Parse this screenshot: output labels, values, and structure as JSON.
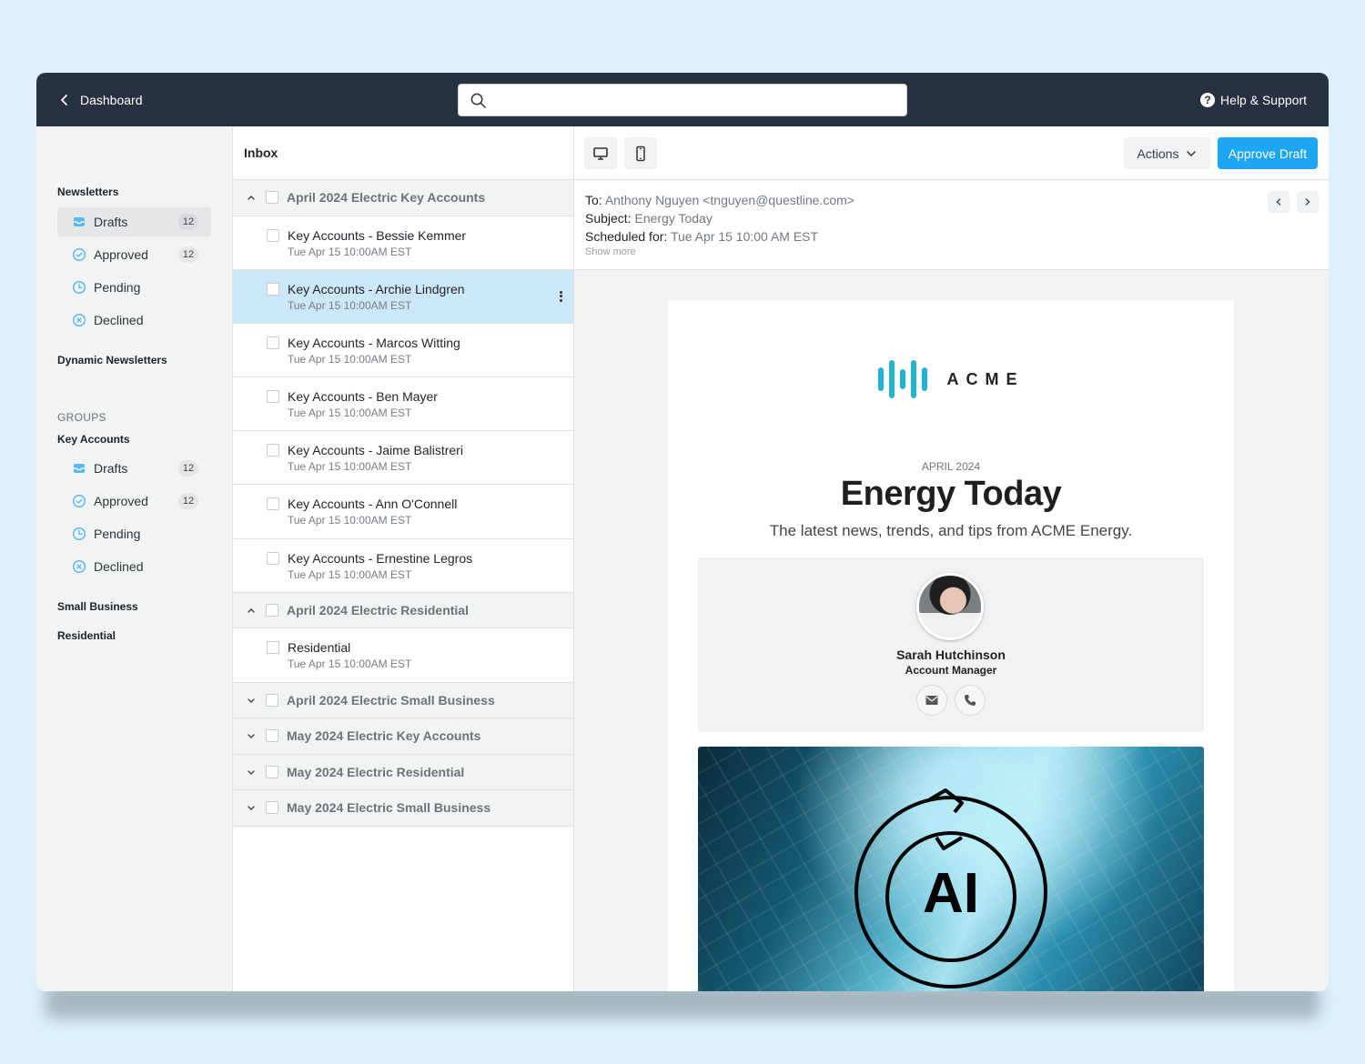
{
  "topbar": {
    "back_label": "Dashboard",
    "search_placeholder": "",
    "help_label": "Help & Support"
  },
  "sidebar": {
    "newsletters_heading": "Newsletters",
    "newsletter_items": [
      {
        "label": "Drafts",
        "count": "12",
        "icon": "inbox-tray-icon",
        "active": true
      },
      {
        "label": "Approved",
        "count": "12",
        "icon": "check-circle-icon"
      },
      {
        "label": "Pending",
        "icon": "clock-icon"
      },
      {
        "label": "Declined",
        "icon": "x-circle-icon"
      }
    ],
    "dynamic_newsletters": "Dynamic Newsletters",
    "groups_label": "GROUPS",
    "key_accounts": "Key Accounts",
    "group_items": [
      {
        "label": "Drafts",
        "count": "12",
        "icon": "inbox-tray-icon"
      },
      {
        "label": "Approved",
        "count": "12",
        "icon": "check-circle-icon"
      },
      {
        "label": "Pending",
        "icon": "clock-icon"
      },
      {
        "label": "Declined",
        "icon": "x-circle-icon"
      }
    ],
    "small_business": "Small Business",
    "residential": "Residential",
    "icon_color": "#5ab8f0"
  },
  "inbox": {
    "title": "Inbox",
    "groups": [
      {
        "label": "April 2024 Electric Key Accounts",
        "expanded": true,
        "messages": [
          {
            "title": "Key Accounts - Bessie Kemmer",
            "time": "Tue Apr 15 10:00AM EST"
          },
          {
            "title": "Key Accounts - Archie Lindgren",
            "time": "Tue Apr 15 10:00AM EST",
            "selected": true
          },
          {
            "title": "Key Accounts - Marcos Witting",
            "time": "Tue Apr 15 10:00AM EST"
          },
          {
            "title": "Key Accounts - Ben Mayer",
            "time": "Tue Apr 15 10:00AM EST"
          },
          {
            "title": "Key Accounts - Jaime Balistreri",
            "time": "Tue Apr 15 10:00AM EST"
          },
          {
            "title": "Key Accounts - Ann O'Connell",
            "time": "Tue Apr 15 10:00AM EST"
          },
          {
            "title": "Key Accounts - Ernestine Legros",
            "time": "Tue Apr 15 10:00AM EST"
          }
        ]
      },
      {
        "label": "April 2024 Electric Residential",
        "expanded": true,
        "messages": [
          {
            "title": "Residential",
            "time": "Tue Apr 15 10:00AM EST"
          }
        ]
      },
      {
        "label": "April 2024 Electric Small Business",
        "expanded": false,
        "messages": []
      },
      {
        "label": "May 2024 Electric Key Accounts",
        "expanded": false,
        "messages": []
      },
      {
        "label": "May 2024 Electric Residential",
        "expanded": false,
        "messages": []
      },
      {
        "label": "May 2024 Electric Small Business",
        "expanded": false,
        "messages": []
      }
    ]
  },
  "preview": {
    "actions_label": "Actions",
    "approve_label": "Approve Draft",
    "approve_color": "#1ea6f2",
    "to_label": "To:",
    "to_value": "Anthony Nguyen <tnguyen@questline.com>",
    "subject_label": "Subject:",
    "subject_value": "Energy Today",
    "scheduled_label": "Scheduled for:",
    "scheduled_value": "Tue Apr 15 10:00 AM EST",
    "show_more": "Show more"
  },
  "email": {
    "brand": "ACME",
    "brand_color": "#21b3cf",
    "issue": "APRIL 2024",
    "headline": "Energy Today",
    "tagline": "The latest news, trends, and tips from ACME Energy.",
    "contact_name": "Sarah Hutchinson",
    "contact_role": "Account Manager",
    "hero_text": "AI"
  }
}
